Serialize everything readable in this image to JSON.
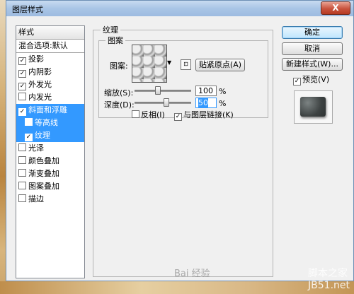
{
  "window": {
    "title": "图层样式",
    "close_glyph": "X"
  },
  "styles_panel": {
    "header": "样式",
    "default": "混合选项:默认",
    "items": [
      {
        "label": "投影",
        "checked": true,
        "selected": false,
        "sub": false
      },
      {
        "label": "内阴影",
        "checked": true,
        "selected": false,
        "sub": false
      },
      {
        "label": "外发光",
        "checked": true,
        "selected": false,
        "sub": false
      },
      {
        "label": "内发光",
        "checked": false,
        "selected": false,
        "sub": false
      },
      {
        "label": "斜面和浮雕",
        "checked": true,
        "selected": true,
        "sub": false
      },
      {
        "label": "等高线",
        "checked": false,
        "selected": true,
        "sub": true
      },
      {
        "label": "纹理",
        "checked": true,
        "selected": true,
        "sub": true
      },
      {
        "label": "光泽",
        "checked": false,
        "selected": false,
        "sub": false
      },
      {
        "label": "颜色叠加",
        "checked": false,
        "selected": false,
        "sub": false
      },
      {
        "label": "渐变叠加",
        "checked": false,
        "selected": false,
        "sub": false
      },
      {
        "label": "图案叠加",
        "checked": false,
        "selected": false,
        "sub": false
      },
      {
        "label": "描边",
        "checked": false,
        "selected": false,
        "sub": false
      }
    ]
  },
  "texture": {
    "group_title": "纹理",
    "pattern_group": "图案",
    "pattern_label": "图案:",
    "snap_button": "贴紧原点(A)",
    "scale_label": "缩放(S):",
    "scale_value": "100",
    "depth_label": "深度(D):",
    "depth_value": "50",
    "unit": "%",
    "invert_label": "反相(I)",
    "invert_checked": false,
    "link_label": "与图层链接(K)",
    "link_checked": true,
    "scale_level": 0.4,
    "depth_level": 0.55
  },
  "buttons": {
    "ok": "确定",
    "cancel": "取消",
    "new_style": "新建样式(W)...",
    "preview_label": "预览(V)",
    "preview_checked": true
  },
  "watermark": {
    "brand": "Bai 经验",
    "site": "脚本之家",
    "url": "JB51.net"
  }
}
